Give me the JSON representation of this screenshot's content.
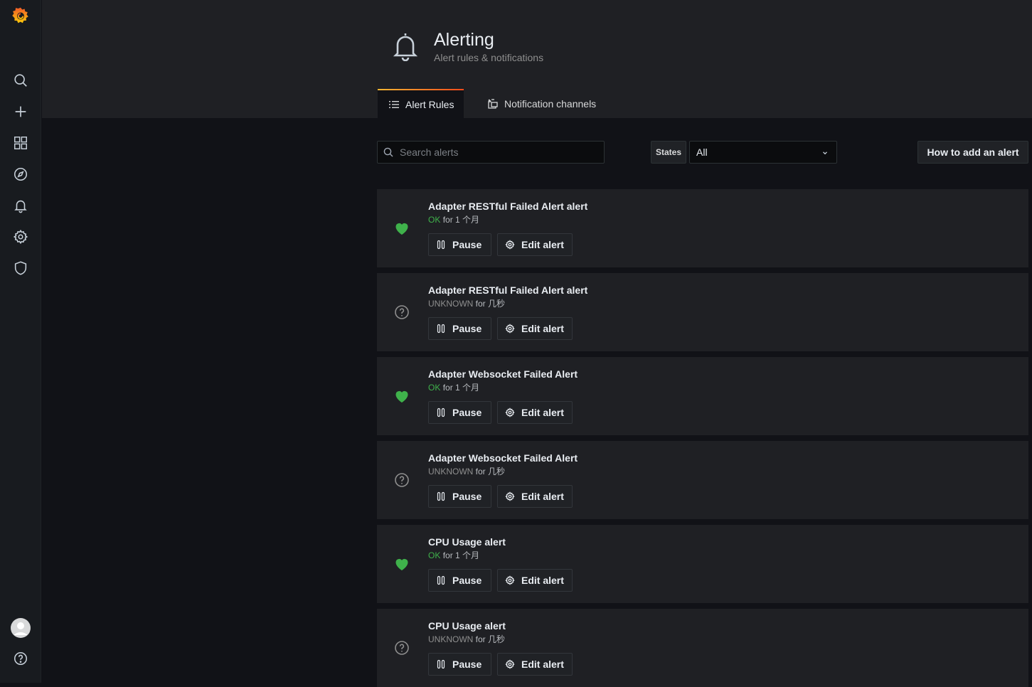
{
  "header": {
    "title": "Alerting",
    "subtitle": "Alert rules & notifications"
  },
  "tabs": [
    {
      "label": "Alert Rules",
      "active": true
    },
    {
      "label": "Notification channels",
      "active": false
    }
  ],
  "toolbar": {
    "search_placeholder": "Search alerts",
    "states_label": "States",
    "states_value": "All",
    "howto_label": "How to add an alert"
  },
  "alerts": [
    {
      "name": "Adapter RESTful Failed Alert alert",
      "state": "OK",
      "duration": "for 1 个月",
      "pause_label": "Pause",
      "edit_label": "Edit alert"
    },
    {
      "name": "Adapter RESTful Failed Alert alert",
      "state": "UNKNOWN",
      "duration": "for 几秒",
      "pause_label": "Pause",
      "edit_label": "Edit alert"
    },
    {
      "name": "Adapter Websocket Failed Alert",
      "state": "OK",
      "duration": "for 1 个月",
      "pause_label": "Pause",
      "edit_label": "Edit alert"
    },
    {
      "name": "Adapter Websocket Failed Alert",
      "state": "UNKNOWN",
      "duration": "for 几秒",
      "pause_label": "Pause",
      "edit_label": "Edit alert"
    },
    {
      "name": "CPU Usage alert",
      "state": "OK",
      "duration": "for 1 个月",
      "pause_label": "Pause",
      "edit_label": "Edit alert"
    },
    {
      "name": "CPU Usage alert",
      "state": "UNKNOWN",
      "duration": "for 几秒",
      "pause_label": "Pause",
      "edit_label": "Edit alert"
    }
  ],
  "colors": {
    "ok": "#3fb14b",
    "unknown": "#8e8e8e",
    "logo_primary": "#f05a28",
    "logo_secondary": "#fbca0a",
    "tab_accent": "#fc4a1a"
  },
  "icons": {
    "sidebar": [
      "grafana-logo-icon",
      "search-icon",
      "plus-icon",
      "dashboards-icon",
      "compass-icon",
      "bell-icon",
      "gear-icon",
      "shield-icon",
      "avatar",
      "help-icon"
    ]
  }
}
